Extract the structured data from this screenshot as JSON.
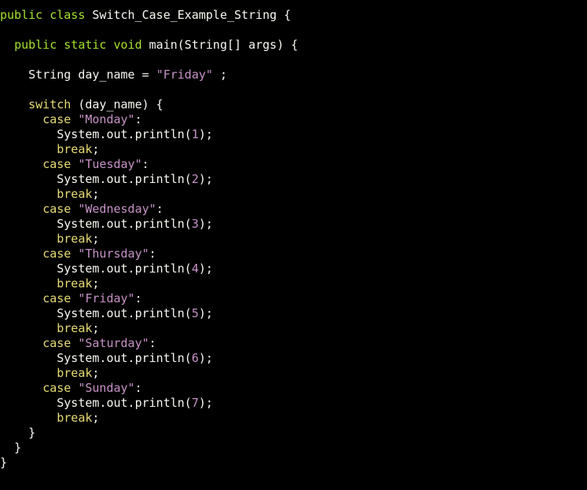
{
  "colors": {
    "background": "#000000",
    "plain": "#f8f8f2",
    "keyword_green": "#a6e22e",
    "keyword_yellow": "#e6db74",
    "string": "#c792c7"
  },
  "code": {
    "lines": [
      [
        {
          "t": "public class",
          "c": "kw"
        },
        {
          "t": " Switch_Case_Example_String {",
          "c": "plain"
        }
      ],
      [],
      [
        {
          "t": "  ",
          "c": "plain"
        },
        {
          "t": "public static void",
          "c": "kw"
        },
        {
          "t": " main(String[] args) {",
          "c": "plain"
        }
      ],
      [],
      [
        {
          "t": "    String day_name = ",
          "c": "plain"
        },
        {
          "t": "\"Friday\"",
          "c": "str"
        },
        {
          "t": " ;",
          "c": "plain"
        }
      ],
      [],
      [
        {
          "t": "    ",
          "c": "plain"
        },
        {
          "t": "switch",
          "c": "kwy"
        },
        {
          "t": " (day_name) {",
          "c": "plain"
        }
      ],
      [
        {
          "t": "      ",
          "c": "plain"
        },
        {
          "t": "case",
          "c": "kwy"
        },
        {
          "t": " ",
          "c": "plain"
        },
        {
          "t": "\"Monday\"",
          "c": "str"
        },
        {
          "t": ":",
          "c": "plain"
        }
      ],
      [
        {
          "t": "        System.out.println(",
          "c": "plain"
        },
        {
          "t": "1",
          "c": "num"
        },
        {
          "t": ");",
          "c": "plain"
        }
      ],
      [
        {
          "t": "        ",
          "c": "plain"
        },
        {
          "t": "break",
          "c": "kwy"
        },
        {
          "t": ";",
          "c": "plain"
        }
      ],
      [
        {
          "t": "      ",
          "c": "plain"
        },
        {
          "t": "case",
          "c": "kwy"
        },
        {
          "t": " ",
          "c": "plain"
        },
        {
          "t": "\"Tuesday\"",
          "c": "str"
        },
        {
          "t": ":",
          "c": "plain"
        }
      ],
      [
        {
          "t": "        System.out.println(",
          "c": "plain"
        },
        {
          "t": "2",
          "c": "num"
        },
        {
          "t": ");",
          "c": "plain"
        }
      ],
      [
        {
          "t": "        ",
          "c": "plain"
        },
        {
          "t": "break",
          "c": "kwy"
        },
        {
          "t": ";",
          "c": "plain"
        }
      ],
      [
        {
          "t": "      ",
          "c": "plain"
        },
        {
          "t": "case",
          "c": "kwy"
        },
        {
          "t": " ",
          "c": "plain"
        },
        {
          "t": "\"Wednesday\"",
          "c": "str"
        },
        {
          "t": ":",
          "c": "plain"
        }
      ],
      [
        {
          "t": "        System.out.println(",
          "c": "plain"
        },
        {
          "t": "3",
          "c": "num"
        },
        {
          "t": ");",
          "c": "plain"
        }
      ],
      [
        {
          "t": "        ",
          "c": "plain"
        },
        {
          "t": "break",
          "c": "kwy"
        },
        {
          "t": ";",
          "c": "plain"
        }
      ],
      [
        {
          "t": "      ",
          "c": "plain"
        },
        {
          "t": "case",
          "c": "kwy"
        },
        {
          "t": " ",
          "c": "plain"
        },
        {
          "t": "\"Thursday\"",
          "c": "str"
        },
        {
          "t": ":",
          "c": "plain"
        }
      ],
      [
        {
          "t": "        System.out.println(",
          "c": "plain"
        },
        {
          "t": "4",
          "c": "num"
        },
        {
          "t": ");",
          "c": "plain"
        }
      ],
      [
        {
          "t": "        ",
          "c": "plain"
        },
        {
          "t": "break",
          "c": "kwy"
        },
        {
          "t": ";",
          "c": "plain"
        }
      ],
      [
        {
          "t": "      ",
          "c": "plain"
        },
        {
          "t": "case",
          "c": "kwy"
        },
        {
          "t": " ",
          "c": "plain"
        },
        {
          "t": "\"Friday\"",
          "c": "str"
        },
        {
          "t": ":",
          "c": "plain"
        }
      ],
      [
        {
          "t": "        System.out.println(",
          "c": "plain"
        },
        {
          "t": "5",
          "c": "num"
        },
        {
          "t": ");",
          "c": "plain"
        }
      ],
      [
        {
          "t": "        ",
          "c": "plain"
        },
        {
          "t": "break",
          "c": "kwy"
        },
        {
          "t": ";",
          "c": "plain"
        }
      ],
      [
        {
          "t": "      ",
          "c": "plain"
        },
        {
          "t": "case",
          "c": "kwy"
        },
        {
          "t": " ",
          "c": "plain"
        },
        {
          "t": "\"Saturday\"",
          "c": "str"
        },
        {
          "t": ":",
          "c": "plain"
        }
      ],
      [
        {
          "t": "        System.out.println(",
          "c": "plain"
        },
        {
          "t": "6",
          "c": "num"
        },
        {
          "t": ");",
          "c": "plain"
        }
      ],
      [
        {
          "t": "        ",
          "c": "plain"
        },
        {
          "t": "break",
          "c": "kwy"
        },
        {
          "t": ";",
          "c": "plain"
        }
      ],
      [
        {
          "t": "      ",
          "c": "plain"
        },
        {
          "t": "case",
          "c": "kwy"
        },
        {
          "t": " ",
          "c": "plain"
        },
        {
          "t": "\"Sunday\"",
          "c": "str"
        },
        {
          "t": ":",
          "c": "plain"
        }
      ],
      [
        {
          "t": "        System.out.println(",
          "c": "plain"
        },
        {
          "t": "7",
          "c": "num"
        },
        {
          "t": ");",
          "c": "plain"
        }
      ],
      [
        {
          "t": "        ",
          "c": "plain"
        },
        {
          "t": "break",
          "c": "kwy"
        },
        {
          "t": ";",
          "c": "plain"
        }
      ],
      [
        {
          "t": "    }",
          "c": "plain"
        }
      ],
      [
        {
          "t": "  }",
          "c": "plain"
        }
      ],
      [
        {
          "t": "}",
          "c": "plain"
        }
      ]
    ]
  }
}
